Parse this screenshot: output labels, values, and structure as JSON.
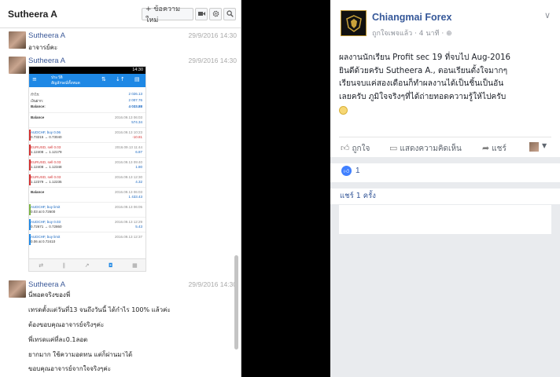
{
  "chat": {
    "title": "Sutheera A",
    "new_message_label": "+ ข้อความใหม่",
    "icons": [
      "video-icon",
      "gear-icon",
      "search-icon"
    ],
    "messages": [
      {
        "sender": "Sutheera A",
        "time": "29/9/2016 14:30",
        "lines": [
          "อาจารย์คะ"
        ]
      },
      {
        "sender": "Sutheera A",
        "time": "29/9/2016 14:30",
        "lines": []
      },
      {
        "sender": "Sutheera A",
        "time": "29/9/2016 14:30",
        "lines": [
          "นี่พอตจริงของพี่",
          "เทรดตั้งแต่วันที่13 จนถึงวันนี้ ได้กำไร 100% แล้วค่ะ",
          "ต้องขอบคุณอาจารย์จริงๆค่ะ",
          "พี่เทรดแค่ที่ละ0.1ลอต",
          "ยากมาก ใช้ความอดทน แต่ก็ผ่านมาได้",
          "ขอบคุณอาจารย์จากใจจริงๆค่ะ"
        ]
      }
    ],
    "phone": {
      "status_time": "14:30",
      "header_title": "ประวัติ",
      "header_subtitle": "สัญลักษณ์ทั้งหมด",
      "summary": [
        {
          "label": "กำไร:",
          "value": "2 026.13"
        },
        {
          "label": "เงินฝาก:",
          "value": "2 007.76"
        },
        {
          "label": "Balance:",
          "value": "4 033.88"
        }
      ],
      "rows": [
        {
          "t1": "Balance",
          "t2": "",
          "d": "2016.09.13 06:03",
          "v": "574.34"
        },
        {
          "t1": "AUDCHF, buy 0.06",
          "t2": "0.73215 → 0.73040",
          "d": "2016.09.13 10:23",
          "v": "-10.81"
        },
        {
          "t1": "EURUSD, sell 0.03",
          "t2": "1.12408 → 1.12179",
          "d": "2016.09.13 11:44",
          "v": "6.87"
        },
        {
          "t1": "EURUSD, sell 0.03",
          "t2": "1.12408 → 1.12348",
          "d": "2016.09.13 09:40",
          "v": "1.80"
        },
        {
          "t1": "EURUSD, sell 0.03",
          "t2": "1.12379 → 1.12235",
          "d": "2016.09.13 12:30",
          "v": "4.32"
        },
        {
          "t1": "Balance",
          "t2": "",
          "d": "2016.09.13 06:03",
          "v": "1 433.43"
        },
        {
          "t1": "AUDCHF, buy limit",
          "t2": "0.03 at 0.72600",
          "d": "2016.09.13 06:05",
          "v": ""
        },
        {
          "t1": "AUDCHF, buy 0.03",
          "t2": "0.72671 → 0.72860",
          "d": "2016.09.13 12:29",
          "v": "5.43"
        },
        {
          "t1": "AUDCHF, buy limit",
          "t2": "0.06 at 0.72410",
          "d": "2016.09.13 12:37",
          "v": ""
        }
      ]
    }
  },
  "post": {
    "page_name": "Chiangmai Forex",
    "meta": "ถูกใจเพจแล้ว · 4 นาที ·",
    "body_lines": [
      "ผลงานนักเรียน Profit sec 19 ที่จบไป Aug-2016",
      "ยินดีด้วยครับ Sutheera A., ตอนเรียนตั้งใจมากๆ",
      "เรียนจบแค่สองเดือนก็ทำผลงานได้เป็นชิ้นเป็นอัน",
      "เลยครับ ภูมิใจจริงๆที่ได้ถ่ายทอดความรู้ให้ไปครับ"
    ],
    "actions": {
      "like": "ถูกใจ",
      "comment": "แสดงความคิดเห็น",
      "share": "แชร์"
    },
    "likes_count": "1",
    "shares_text": "แชร์ 1 ครั้ง"
  }
}
